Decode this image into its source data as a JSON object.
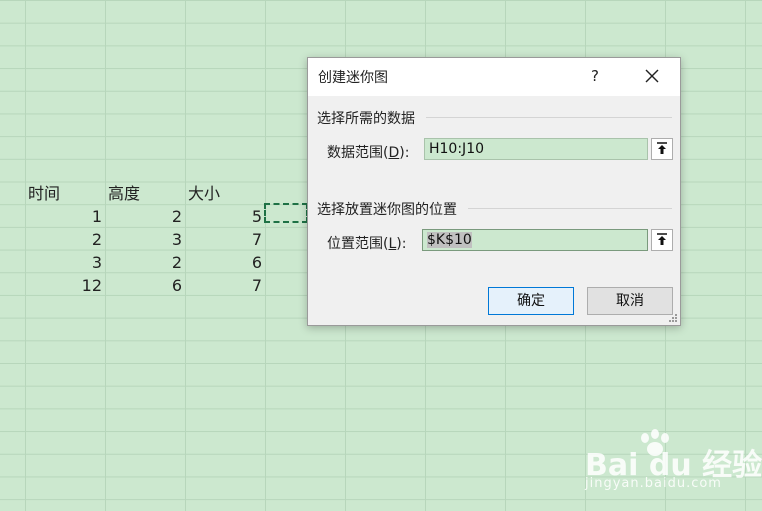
{
  "sheet": {
    "headers": [
      "时间",
      "高度",
      "大小"
    ],
    "rows": [
      [
        "1",
        "2",
        "5"
      ],
      [
        "2",
        "3",
        "7"
      ],
      [
        "3",
        "2",
        "6"
      ],
      [
        "12",
        "6",
        "7"
      ]
    ]
  },
  "dialog": {
    "title": "创建迷你图",
    "help": "?",
    "data_group_label": "选择所需的数据",
    "data_range_label_prefix": "数据范围(",
    "data_range_hotkey": "D",
    "data_range_label_suffix": "):",
    "data_range_value": "H10:J10",
    "location_group_label": "选择放置迷你图的位置",
    "location_range_label_prefix": "位置范围(",
    "location_range_hotkey": "L",
    "location_range_label_suffix": "):",
    "location_range_value": "$K$10",
    "ok_label": "确定",
    "cancel_label": "取消"
  },
  "watermark": {
    "brand": "Bai du 经验",
    "url": "jingyan.baidu.com"
  },
  "colors": {
    "sheet_bg": "#cce8cf",
    "ok_border": "#0078d7",
    "marquee": "#1e7145"
  }
}
